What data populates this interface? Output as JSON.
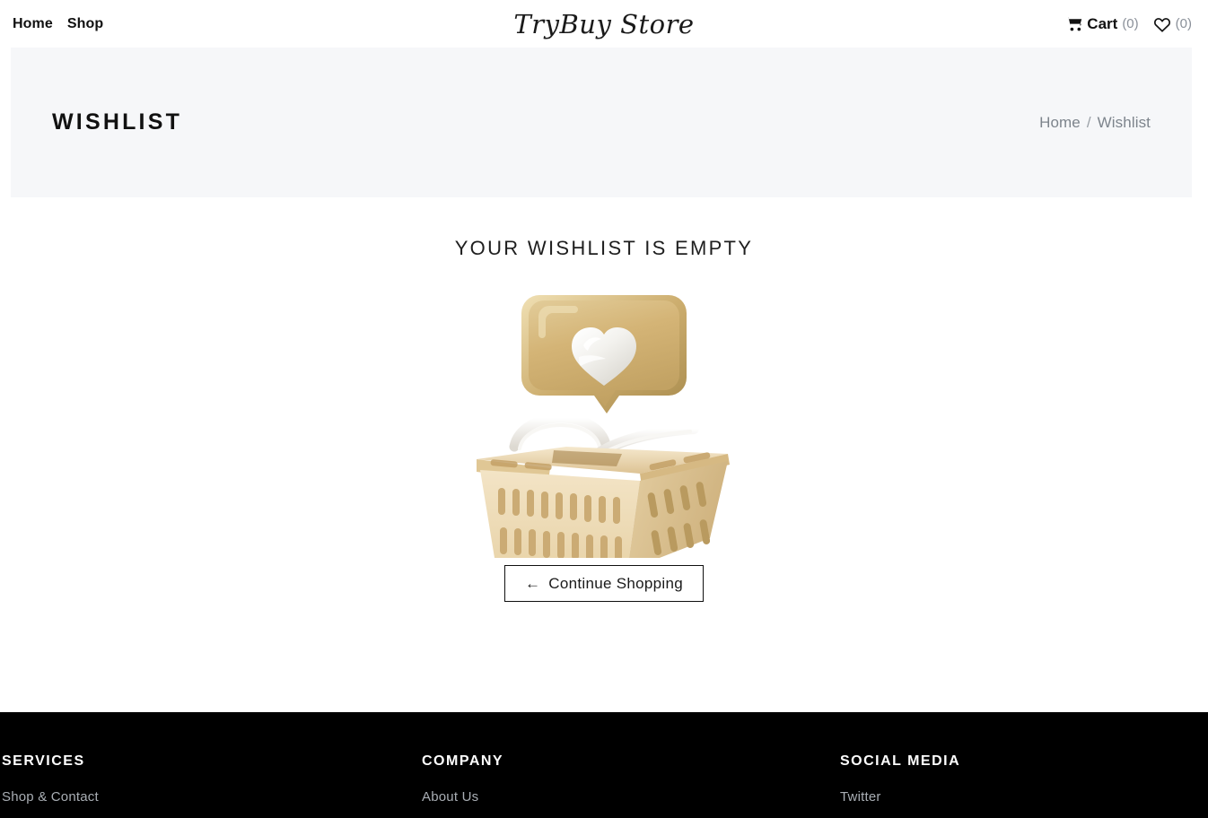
{
  "header": {
    "nav": [
      {
        "label": "Home"
      },
      {
        "label": "Shop"
      }
    ],
    "logo": "TryBuy Store",
    "cart": {
      "icon": "shopping-cart-icon",
      "label": "Cart",
      "count": "(0)"
    },
    "wishlist": {
      "icon": "heart-icon",
      "count": "(0)"
    }
  },
  "banner": {
    "title": "WISHLIST",
    "breadcrumb": {
      "home": "Home",
      "separator": "/",
      "current": "Wishlist"
    }
  },
  "main": {
    "empty_title": "YOUR WISHLIST IS EMPTY",
    "illustration": {
      "name": "empty-wishlist-basket-illustration",
      "gold": "#d4b476",
      "gold_dark": "#b99a58",
      "gold_light": "#e8d4a4",
      "basket_body": "#f0e0c0",
      "basket_shadow": "#d8c092",
      "heart_white": "#f4f4f2",
      "handle_white": "#eceae6"
    },
    "continue_button": {
      "arrow": "←",
      "label": "Continue Shopping"
    }
  },
  "footer": {
    "columns": [
      {
        "heading": "SERVICES",
        "links": [
          {
            "label": "Shop & Contact"
          }
        ]
      },
      {
        "heading": "COMPANY",
        "links": [
          {
            "label": "About Us"
          }
        ]
      },
      {
        "heading": "SOCIAL MEDIA",
        "links": [
          {
            "label": "Twitter"
          }
        ]
      }
    ]
  }
}
